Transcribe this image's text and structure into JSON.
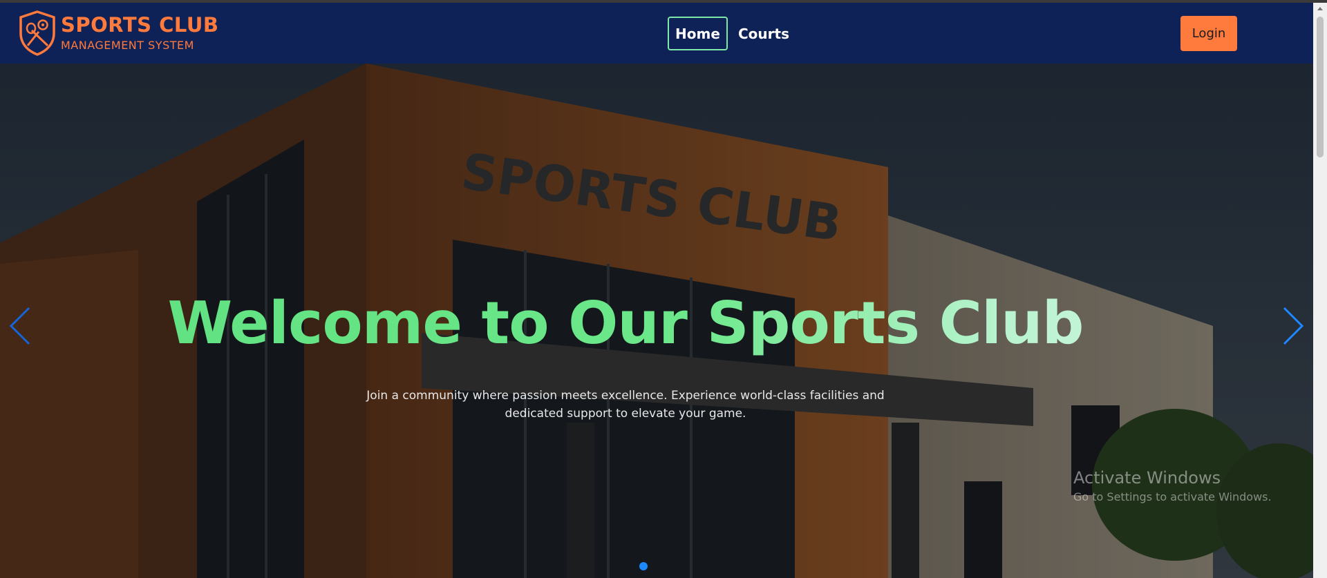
{
  "brand": {
    "title": "SPORTS CLUB",
    "subtitle": "MANAGEMENT SYSTEM",
    "logo_icon": "shield-sports-logo-icon"
  },
  "nav": {
    "items": [
      {
        "label": "Home",
        "active": true
      },
      {
        "label": "Courts",
        "active": false
      }
    ],
    "login_label": "Login"
  },
  "hero": {
    "title": "Welcome to Our Sports Club",
    "subtitle": "Join a community where passion meets excellence. Experience world-class facilities and dedicated support to elevate your game.",
    "building_sign": "SPORTS CLUB",
    "prev_icon": "chevron-left-icon",
    "next_icon": "chevron-right-icon",
    "slide_count": 1,
    "active_slide": 1
  },
  "watermark": {
    "title": "Activate Windows",
    "subtitle": "Go to Settings to activate Windows."
  },
  "colors": {
    "navbar": "#0f2257",
    "accent_orange": "#ff7a3d",
    "accent_green": "#5ee07f",
    "home_border": "#7ee8a8",
    "indicator": "#1e88ff"
  }
}
